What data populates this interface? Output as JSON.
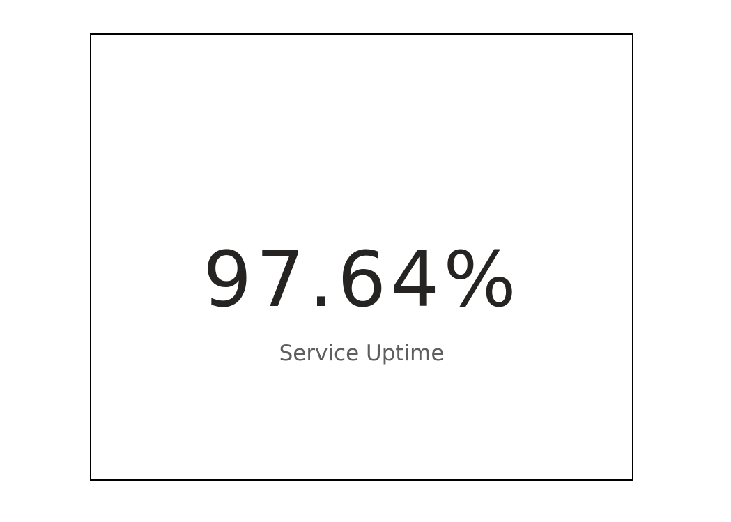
{
  "chart_data": {
    "type": "table",
    "value": 97.64,
    "value_text": "97.64%",
    "label": "Service Uptime"
  },
  "colors": {
    "value": "#252423",
    "label": "#605e5c",
    "border": "#000000",
    "background": "#ffffff"
  }
}
